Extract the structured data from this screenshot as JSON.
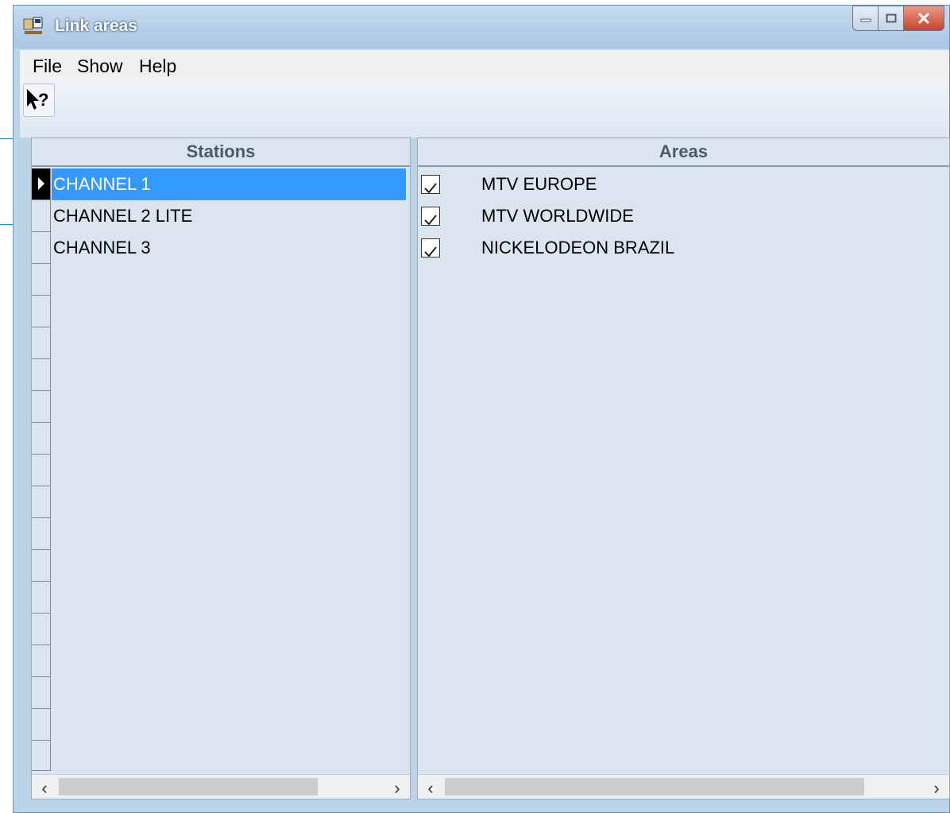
{
  "window": {
    "title": "Link areas"
  },
  "menu": [
    "File",
    "Show",
    "Help"
  ],
  "toolbar": {
    "help_tool_label": "↖?"
  },
  "stations": {
    "header": "Stations",
    "items": [
      "CHANNEL 1",
      "CHANNEL 2 LITE",
      "CHANNEL 3"
    ],
    "selected_index": 0
  },
  "areas": {
    "header": "Areas",
    "items": [
      {
        "label": "MTV  EUROPE",
        "checked": true
      },
      {
        "label": "MTV WORLDWIDE",
        "checked": true
      },
      {
        "label": "NICKELODEON BRAZIL",
        "checked": true
      }
    ]
  },
  "colors": {
    "selection": "#3399ff",
    "window_frame": "#bcd3e8",
    "close_button": "#c7432a"
  }
}
